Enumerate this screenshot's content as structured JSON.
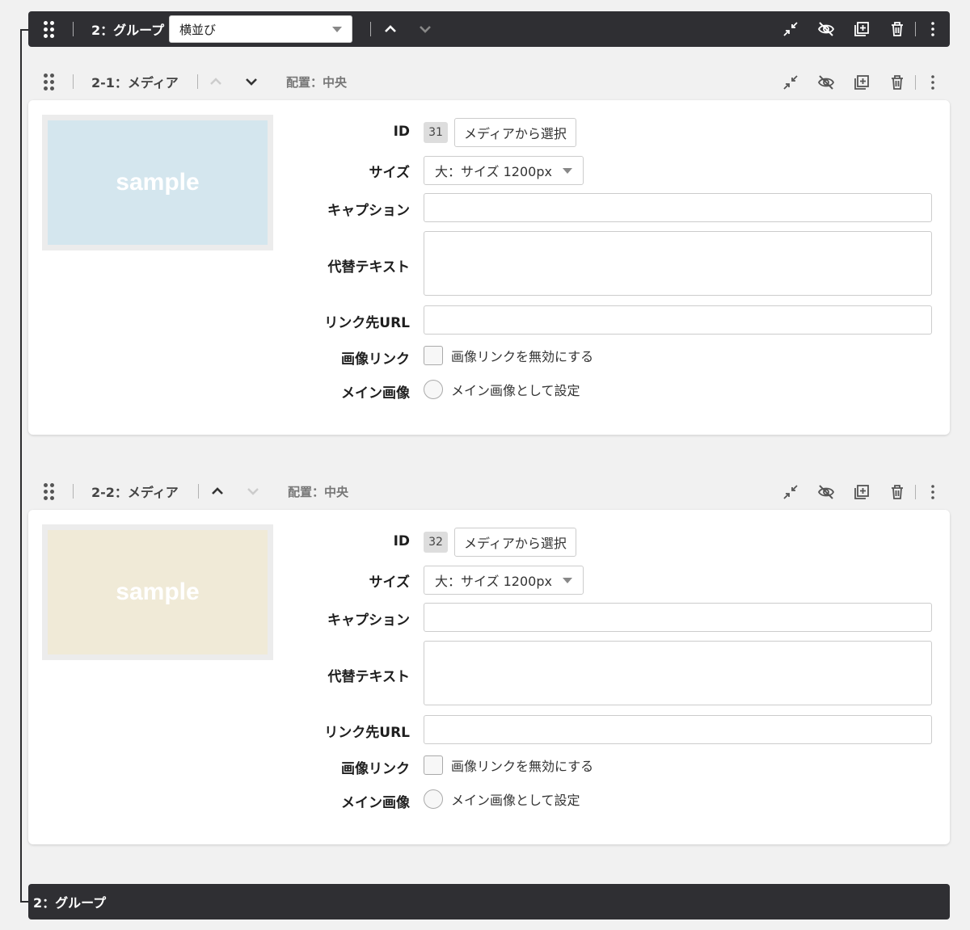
{
  "group": {
    "title": "2：グループ",
    "layout_value": "横並び",
    "footer_title": "2：グループ"
  },
  "blocks": [
    {
      "title": "2-1：メディア",
      "align": "配置：中央",
      "thumb_text": "sample",
      "thumb_color": "#d4e6ee",
      "labels": {
        "id": "ID",
        "size": "サイズ",
        "caption": "キャプション",
        "alt": "代替テキスト",
        "link": "リンク先URL",
        "img_link": "画像リンク",
        "main": "メイン画像"
      },
      "id_value": "31",
      "select_media": "メディアから選択",
      "size_value": "大：サイズ 1200px",
      "caption_value": "",
      "alt_value": "",
      "link_value": "",
      "disable_link_label": "画像リンクを無効にする",
      "main_image_label": "メイン画像として設定",
      "up_enabled": false,
      "down_enabled": true
    },
    {
      "title": "2-2：メディア",
      "align": "配置：中央",
      "thumb_text": "sample",
      "thumb_color": "#f0ead7",
      "labels": {
        "id": "ID",
        "size": "サイズ",
        "caption": "キャプション",
        "alt": "代替テキスト",
        "link": "リンク先URL",
        "img_link": "画像リンク",
        "main": "メイン画像"
      },
      "id_value": "32",
      "select_media": "メディアから選択",
      "size_value": "大：サイズ 1200px",
      "caption_value": "",
      "alt_value": "",
      "link_value": "",
      "disable_link_label": "画像リンクを無効にする",
      "main_image_label": "メイン画像として設定",
      "up_enabled": true,
      "down_enabled": false
    }
  ],
  "icons": [
    "drag-handle-icon",
    "chevron-up-icon",
    "chevron-down-icon",
    "collapse-icon",
    "eye-off-icon",
    "duplicate-icon",
    "trash-icon",
    "more-vertical-icon"
  ]
}
